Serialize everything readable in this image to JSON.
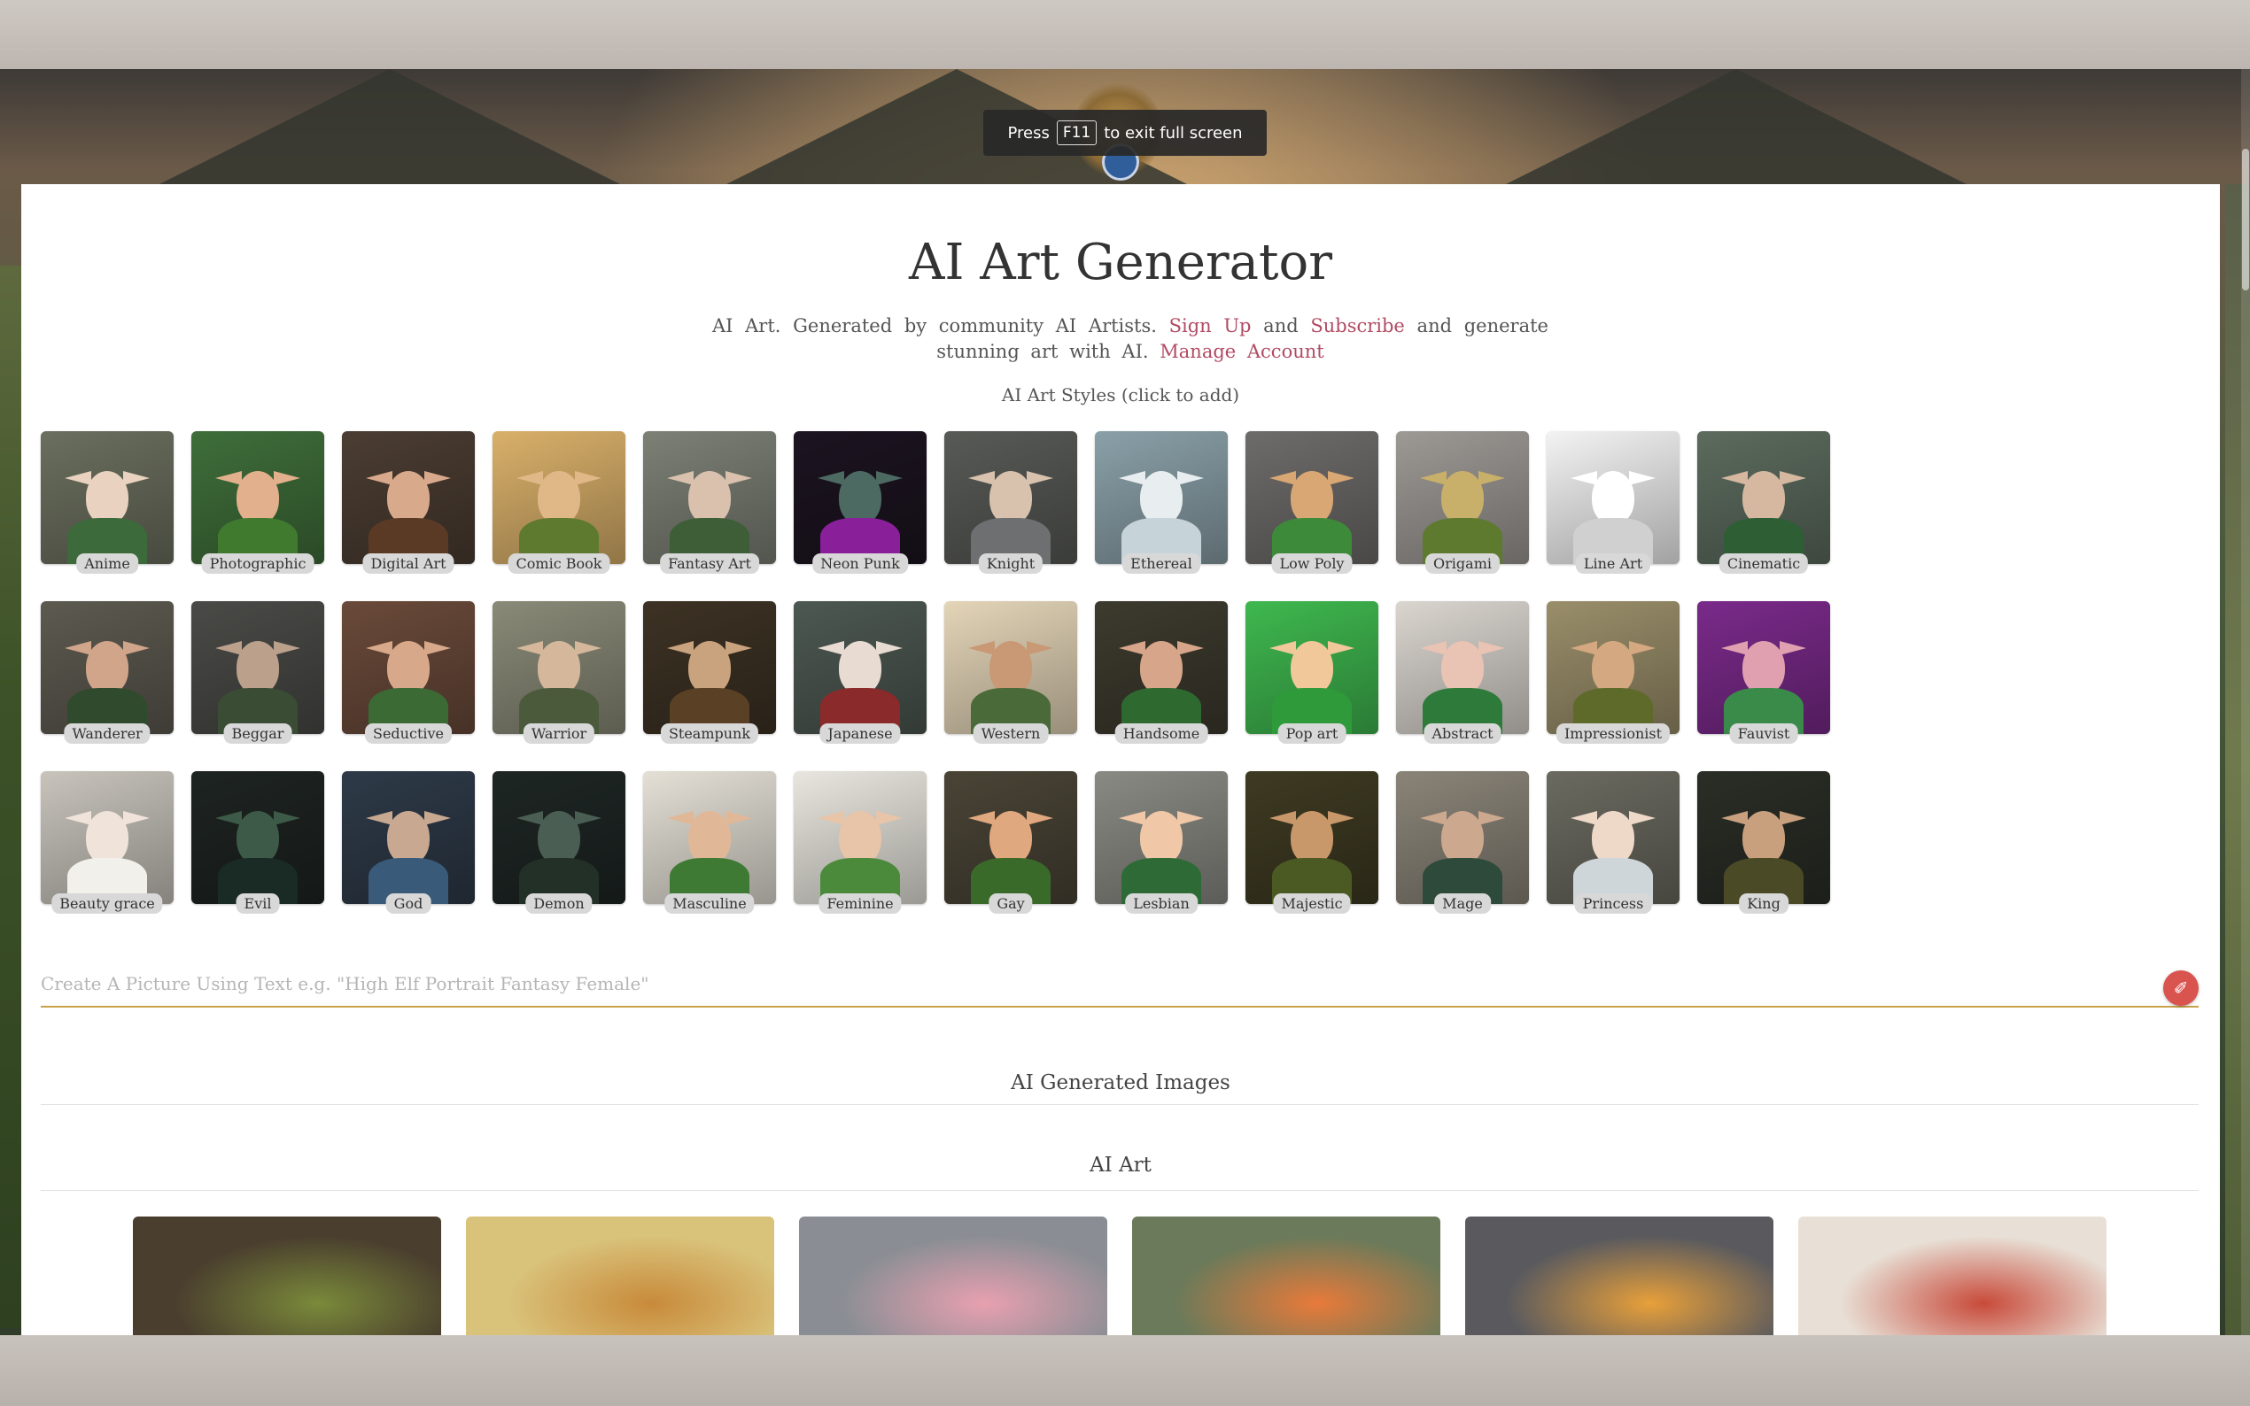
{
  "fullscreen_notice": {
    "prefix": "Press",
    "key": "F11",
    "suffix": "to exit full screen"
  },
  "header": {
    "title": "AI Art Generator"
  },
  "intro": {
    "part1": "AI Art. Generated by community AI Artists.",
    "signup_link": "Sign Up",
    "and": "and",
    "subscribe_link": "Subscribe",
    "part2": "and generate stunning art with AI.",
    "manage_link": "Manage Account"
  },
  "styles": {
    "caption": "AI Art Styles (click to add)",
    "items": [
      {
        "label": "Anime",
        "bg": "#6b6f5e",
        "skin": "#e9d2bf",
        "cloth": "#3d6a3a"
      },
      {
        "label": "Photographic",
        "bg": "#3f6e3a",
        "skin": "#e2b08c",
        "cloth": "#3f7a2f"
      },
      {
        "label": "Digital Art",
        "bg": "#4b3d32",
        "skin": "#d9a98c",
        "cloth": "#5b3a25"
      },
      {
        "label": "Comic Book",
        "bg": "#d9b06a",
        "skin": "#e0b887",
        "cloth": "#5d7a2f"
      },
      {
        "label": "Fantasy Art",
        "bg": "#7c8075",
        "skin": "#d9c1ae",
        "cloth": "#3d5e36"
      },
      {
        "label": "Neon Punk",
        "bg": "#1c1420",
        "skin": "#4d6a62",
        "cloth": "#8a1f9a"
      },
      {
        "label": "Knight",
        "bg": "#585a56",
        "skin": "#d8c2ae",
        "cloth": "#6d6f70"
      },
      {
        "label": "Ethereal",
        "bg": "#8aa0a8",
        "skin": "#e8eef0",
        "cloth": "#c6d4da"
      },
      {
        "label": "Low Poly",
        "bg": "#6e6c6a",
        "skin": "#d8a774",
        "cloth": "#3d8a3a"
      },
      {
        "label": "Origami",
        "bg": "#9d9995",
        "skin": "#c8b06a",
        "cloth": "#5e7a2f"
      },
      {
        "label": "Line Art",
        "bg": "#f3f3f3",
        "skin": "#ffffff",
        "cloth": "#d0d0d0"
      },
      {
        "label": "Cinematic",
        "bg": "#5c6b5e",
        "skin": "#d6b8a0",
        "cloth": "#2e5e34"
      },
      {
        "label": "Wanderer",
        "bg": "#5d5a50",
        "skin": "#d1a58a",
        "cloth": "#2f4a2c"
      },
      {
        "label": "Beggar",
        "bg": "#4a4a47",
        "skin": "#bba18c",
        "cloth": "#3a4c34"
      },
      {
        "label": "Seductive",
        "bg": "#6a4a3a",
        "skin": "#d8a88a",
        "cloth": "#3b6a35"
      },
      {
        "label": "Warrior",
        "bg": "#8a8a78",
        "skin": "#d5b89c",
        "cloth": "#4a5a3a"
      },
      {
        "label": "Steampunk",
        "bg": "#3d3224",
        "skin": "#c9a27e",
        "cloth": "#5a4025"
      },
      {
        "label": "Japanese",
        "bg": "#4d5852",
        "skin": "#e8dcd2",
        "cloth": "#8a2a2a"
      },
      {
        "label": "Western",
        "bg": "#e4d5b8",
        "skin": "#c99874",
        "cloth": "#4a6a3a"
      },
      {
        "label": "Handsome",
        "bg": "#3d3a2e",
        "skin": "#d6a58a",
        "cloth": "#2e6a30"
      },
      {
        "label": "Pop art",
        "bg": "#3fb84f",
        "skin": "#f0c89a",
        "cloth": "#2f9a3a"
      },
      {
        "label": "Abstract",
        "bg": "#dad5cf",
        "skin": "#e9c3b4",
        "cloth": "#2e7a3a"
      },
      {
        "label": "Impressionist",
        "bg": "#9a8e6a",
        "skin": "#d4a880",
        "cloth": "#5e6a2a"
      },
      {
        "label": "Fauvist",
        "bg": "#7a2a8a",
        "skin": "#e0a0b0",
        "cloth": "#3a8a4a"
      },
      {
        "label": "Beauty grace",
        "bg": "#c8c4bc",
        "skin": "#f0e4da",
        "cloth": "#f2f0ea"
      },
      {
        "label": "Evil",
        "bg": "#1e2422",
        "skin": "#3d5a48",
        "cloth": "#1a2a24"
      },
      {
        "label": "God",
        "bg": "#2e3a48",
        "skin": "#c8a890",
        "cloth": "#3a5a7a"
      },
      {
        "label": "Demon",
        "bg": "#1e2624",
        "skin": "#4a5e54",
        "cloth": "#233028"
      },
      {
        "label": "Masculine",
        "bg": "#e4e0d6",
        "skin": "#e0b898",
        "cloth": "#3e7a34"
      },
      {
        "label": "Feminine",
        "bg": "#e8e6de",
        "skin": "#e8c4a8",
        "cloth": "#4a8a3a"
      },
      {
        "label": "Gay",
        "bg": "#4a4436",
        "skin": "#e0a87e",
        "cloth": "#3a6a2a"
      },
      {
        "label": "Lesbian",
        "bg": "#8a8a84",
        "skin": "#f0c8a8",
        "cloth": "#2e6a36"
      },
      {
        "label": "Majestic",
        "bg": "#3e3a22",
        "skin": "#c8986a",
        "cloth": "#4a5a22"
      },
      {
        "label": "Mage",
        "bg": "#8a8478",
        "skin": "#cca88e",
        "cloth": "#2e4a3a"
      },
      {
        "label": "Princess",
        "bg": "#6a6a60",
        "skin": "#eed8c8",
        "cloth": "#cfd6da"
      },
      {
        "label": "King",
        "bg": "#2a2e26",
        "skin": "#c8a07e",
        "cloth": "#4a4a26"
      }
    ]
  },
  "prompt": {
    "placeholder": "Create A Picture Using Text e.g. \"High Elf Portrait Fantasy Female\"",
    "value": ""
  },
  "generate_icon": "paint-brush-icon",
  "sections": {
    "generated_title": "AI Generated Images",
    "art_title": "AI Art"
  },
  "gallery": [
    {
      "bg": "#4a3e2e",
      "accent": "#7a8a3a"
    },
    {
      "bg": "#d9c27a",
      "accent": "#c88a3a"
    },
    {
      "bg": "#8a8e94",
      "accent": "#e8a0b0"
    },
    {
      "bg": "#6a7a5a",
      "accent": "#e87a3a"
    },
    {
      "bg": "#5a5a5e",
      "accent": "#e8a03a"
    },
    {
      "bg": "#e8e0d6",
      "accent": "#c84a3a"
    }
  ]
}
